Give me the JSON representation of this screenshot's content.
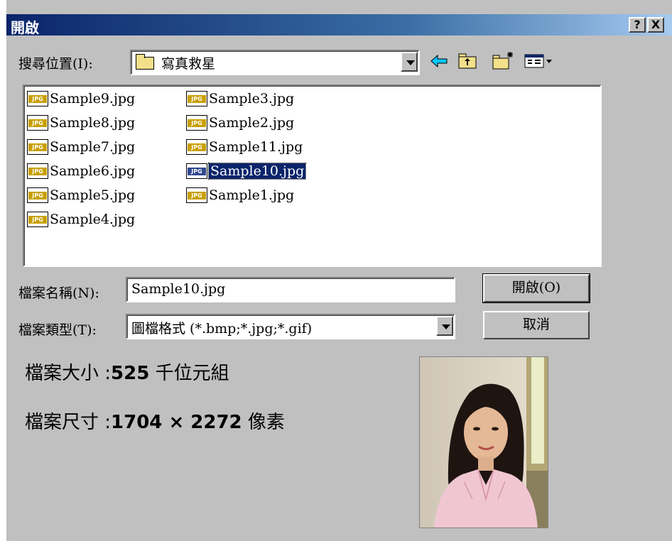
{
  "window": {
    "title": "開啟",
    "help_label": "?",
    "close_label": "X"
  },
  "lookin": {
    "label": "搜尋位置(I):",
    "value": "寫真救星"
  },
  "toolbar": {
    "back_icon": "back-arrow-icon",
    "up_icon": "up-folder-icon",
    "new_folder_icon": "new-folder-icon",
    "view_icon": "view-menu-icon"
  },
  "files": [
    {
      "name": "Sample9.jpg",
      "selected": false
    },
    {
      "name": "Sample8.jpg",
      "selected": false
    },
    {
      "name": "Sample7.jpg",
      "selected": false
    },
    {
      "name": "Sample6.jpg",
      "selected": false
    },
    {
      "name": "Sample5.jpg",
      "selected": false
    },
    {
      "name": "Sample4.jpg",
      "selected": false
    },
    {
      "name": "Sample3.jpg",
      "selected": false
    },
    {
      "name": "Sample2.jpg",
      "selected": false
    },
    {
      "name": "Sample11.jpg",
      "selected": false
    },
    {
      "name": "Sample10.jpg",
      "selected": true
    },
    {
      "name": "Sample1.jpg",
      "selected": false
    }
  ],
  "file_icon_label": "JPG",
  "filename": {
    "label": "檔案名稱(N):",
    "value": "Sample10.jpg"
  },
  "filetype": {
    "label": "檔案類型(T):",
    "value": "圖檔格式 (*.bmp;*.jpg;*.gif)"
  },
  "buttons": {
    "open": "開啟(O)",
    "cancel": "取消"
  },
  "info": {
    "size_label": "檔案大小 :",
    "size_value": "525",
    "size_unit": " 千位元組",
    "dim_label": "檔案尺寸 :",
    "dim_value": "1704 × 2272",
    "dim_unit": " 像素"
  },
  "colors": {
    "titlebar_start": "#0a246a",
    "titlebar_end": "#a6caf0",
    "selection": "#0a246a",
    "dialog_bg": "#c0c0c0"
  }
}
